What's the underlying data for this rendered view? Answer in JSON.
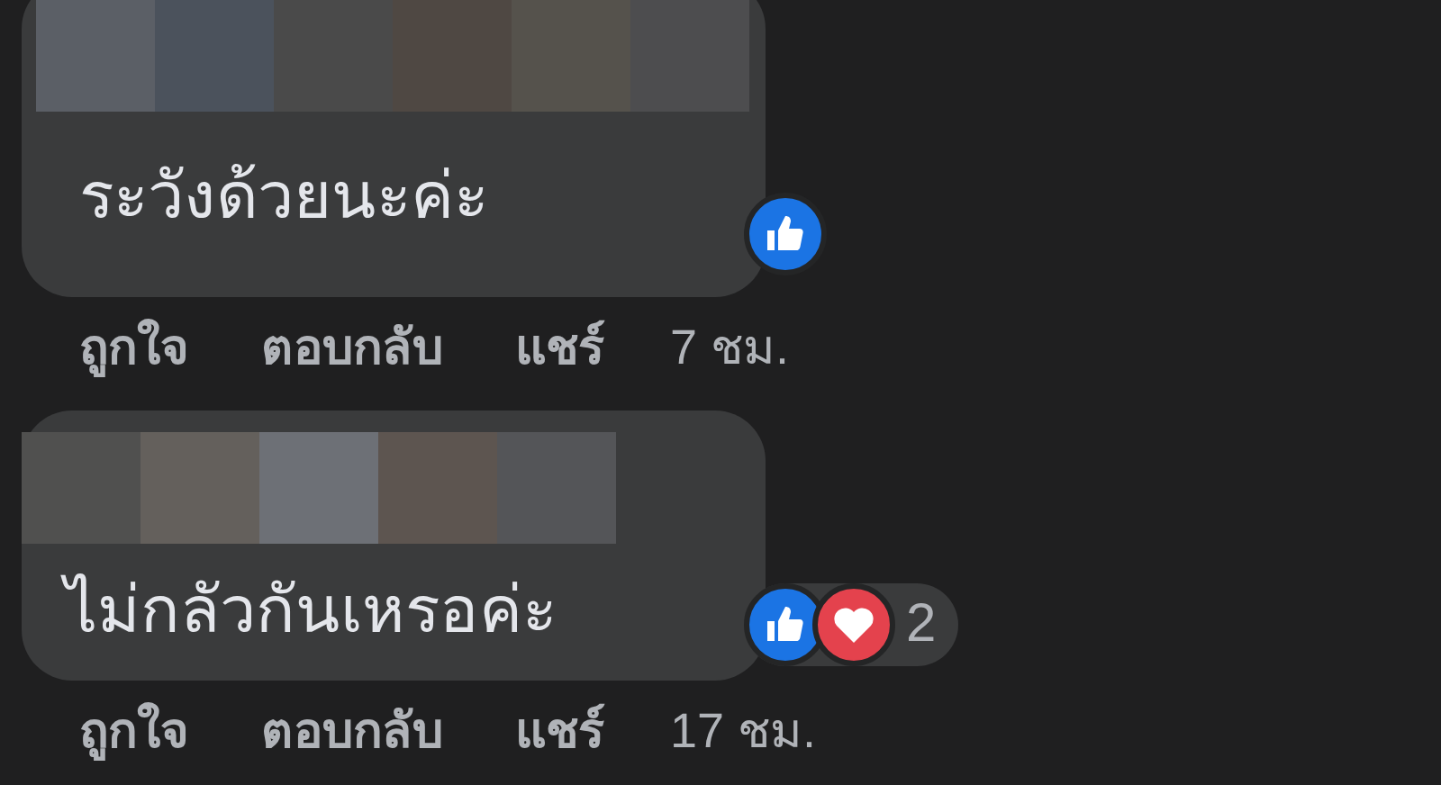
{
  "comments": [
    {
      "text": "ระวังด้วยนะค่ะ",
      "reactions": [
        {
          "kind": "like"
        }
      ],
      "actions": [
        "ถูกใจ",
        "ตอบกลับ",
        "แชร์"
      ],
      "time": "7 ชม."
    },
    {
      "text": "ไม่กลัวกันเหรอค่ะ",
      "reactions": [
        {
          "kind": "like"
        },
        {
          "kind": "love"
        }
      ],
      "reaction_count": "2",
      "actions": [
        "ถูกใจ",
        "ตอบกลับ",
        "แชร์"
      ],
      "time": "17 ชม."
    }
  ]
}
